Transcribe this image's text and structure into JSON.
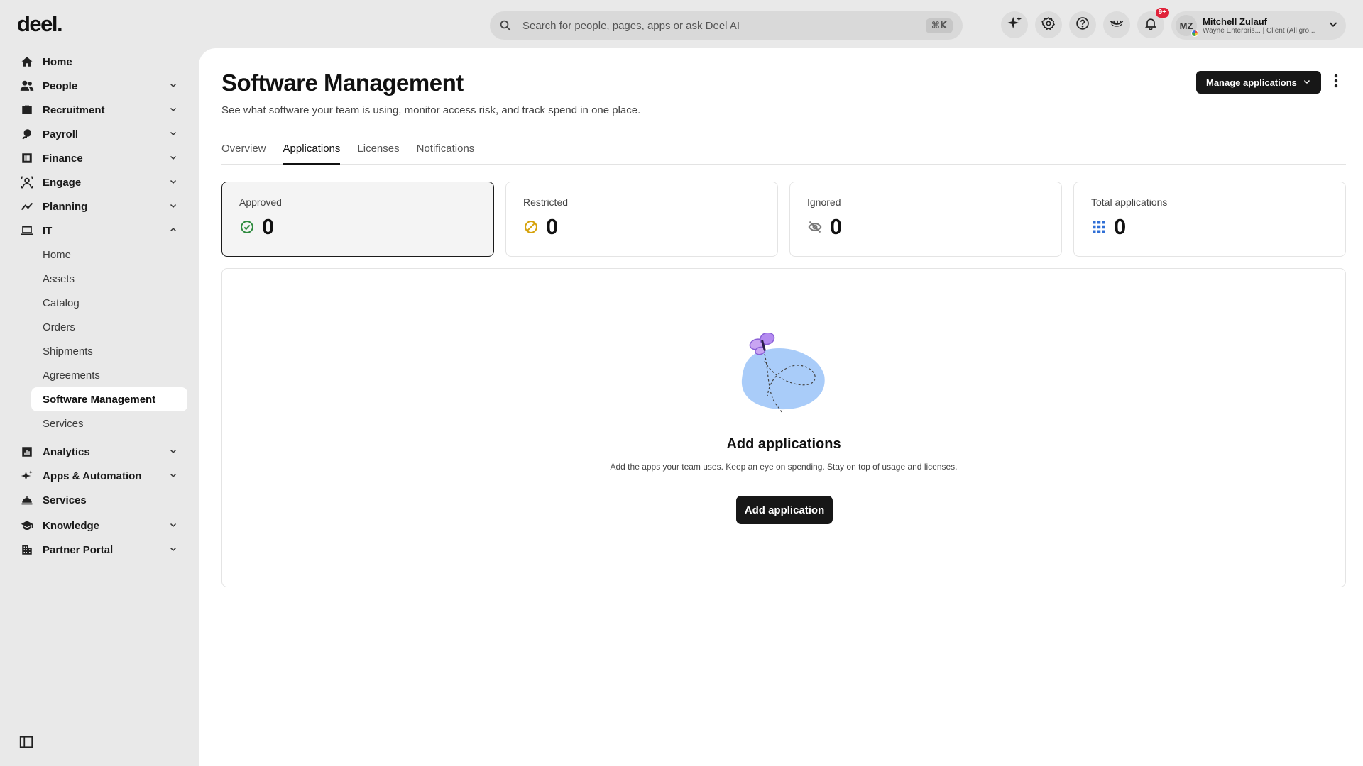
{
  "brand": {
    "logo": "deel."
  },
  "topbar": {
    "search_placeholder": "Search for people, pages, apps or ask Deel AI",
    "search_shortcut": "⌘K",
    "icons": [
      "sparkle-icon",
      "gear-icon",
      "help-icon",
      "eye-closed-icon",
      "bell-icon"
    ],
    "notification_badge": "9+",
    "user": {
      "initials": "MZ",
      "name": "Mitchell Zulauf",
      "subtitle": "Wayne Enterpris... | Client (All gro..."
    }
  },
  "sidebar": {
    "items": [
      {
        "label": "Home"
      },
      {
        "label": "People"
      },
      {
        "label": "Recruitment"
      },
      {
        "label": "Payroll"
      },
      {
        "label": "Finance"
      },
      {
        "label": "Engage"
      },
      {
        "label": "Planning"
      },
      {
        "label": "IT"
      }
    ],
    "it_sub": [
      "Home",
      "Assets",
      "Catalog",
      "Orders",
      "Shipments",
      "Agreements",
      "Software Management",
      "Services"
    ],
    "items_after": [
      {
        "label": "Analytics"
      },
      {
        "label": "Apps & Automation"
      },
      {
        "label": "Services"
      },
      {
        "label": "Knowledge"
      },
      {
        "label": "Partner Portal"
      }
    ]
  },
  "main": {
    "title": "Software Management",
    "subtitle": "See what software your team is using, monitor access risk, and track spend in one place.",
    "manage_button": "Manage applications",
    "tabs": [
      "Overview",
      "Applications",
      "Licenses",
      "Notifications"
    ],
    "active_tab": "Applications",
    "stats": [
      {
        "label": "Approved",
        "value": "0",
        "color": "#2e8b3e"
      },
      {
        "label": "Restricted",
        "value": "0",
        "color": "#d6a20a"
      },
      {
        "label": "Ignored",
        "value": "0",
        "color": "#777777"
      },
      {
        "label": "Total applications",
        "value": "0",
        "color": "#2f6fd6"
      }
    ],
    "empty": {
      "title": "Add applications",
      "description": "Add the apps your team uses. Keep an eye on spending. Stay on top of usage and licenses.",
      "button": "Add application"
    }
  }
}
